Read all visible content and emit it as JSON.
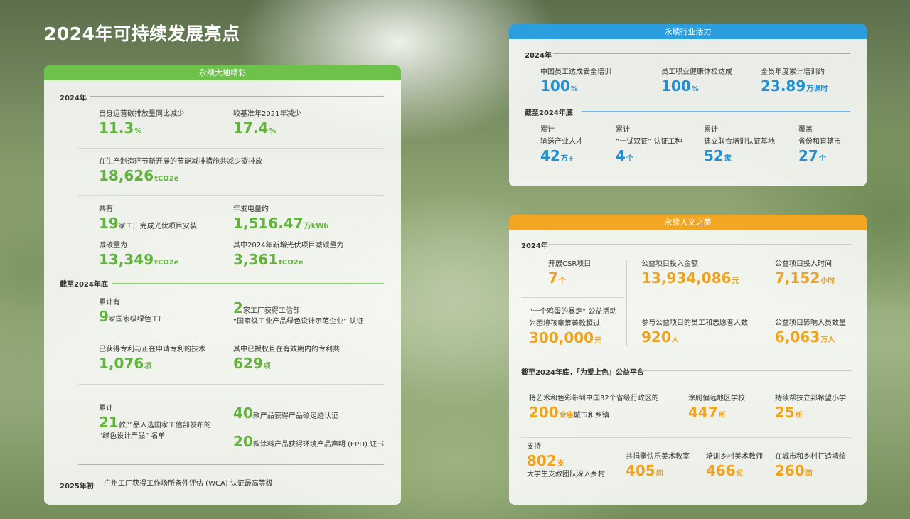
{
  "page_title": "2024年可持续发展亮点",
  "colors": {
    "green": "#5fb53a",
    "blue": "#1f8fd6",
    "orange": "#f0a21c"
  },
  "green_panel": {
    "header": "永续大地精彩",
    "sec_2024": "2024年",
    "emission_label": "自身运营碳排放量同比减少",
    "emission_value": "11.3",
    "emission_unit": "%",
    "baseline_label": "较基准年2021年减少",
    "baseline_value": "17.4",
    "baseline_unit": "%",
    "energy_label": "在生产制造环节新开展的节能减排措施共减少碳排放",
    "energy_value": "18,626",
    "energy_unit": "tCO2e",
    "pv_prefix": "共有",
    "pv_value": "19",
    "pv_suffix": "家工厂完成光伏项目安装",
    "power_label": "年发电量约",
    "power_value": "1,516.47",
    "power_unit": "万kWh",
    "reduce_label": "减碳量为",
    "reduce_value": "13,349",
    "reduce_unit": "tCO2e",
    "newpv_label": "其中2024年新增光伏项目减碳量为",
    "newpv_value": "3,361",
    "newpv_unit": "tCO2e",
    "sec_end": "截至2024年底",
    "green_factory_prefix": "累计有",
    "green_factory_value": "9",
    "green_factory_suffix": "家国家级绿色工厂",
    "miit_value": "2",
    "miit_suffix": "家工厂获得工信部",
    "miit_note": "“国家级工业产品绿色设计示范企业” 认证",
    "patent_label": "已获得专利与正在申请专利的技术",
    "patent_value": "1,076",
    "patent_unit": "项",
    "valid_label": "其中已授权且在有效期内的专利共",
    "valid_value": "629",
    "valid_unit": "项",
    "gd_prefix": "累计",
    "gd_value": "21",
    "gd_suffix": "款产品入选国家工信部发布的",
    "gd_note": "“绿色设计产品” 名单",
    "cf_value": "40",
    "cf_suffix": "款产品获得产品碳足迹认证",
    "epd_value": "20",
    "epd_suffix": "款涂料产品获得环境产品声明 (EPD) 证书",
    "year2025": "2025年初",
    "wca": "广州工厂获得工作场所条件评估 (WCA) 认证最高等级"
  },
  "blue_panel": {
    "header": "永续行业活力",
    "sec_2024": "2024年",
    "safety_label": "中国员工达成安全培训",
    "safety_value": "100",
    "safety_unit": "%",
    "health_label": "员工职业健康体检达成",
    "health_value": "100",
    "health_unit": "%",
    "train_label": "全员年度累计培训约",
    "train_value": "23.89",
    "train_unit": "万课时",
    "sec_end": "截至2024年底",
    "talent_l1": "累计",
    "talent_l2": "输送产业人才",
    "talent_value": "42",
    "talent_unit": "万+",
    "cert_l1": "累计",
    "cert_l2": "“一试双证” 认证工种",
    "cert_value": "4",
    "cert_unit": "个",
    "base_l1": "累计",
    "base_l2": "建立联合培训认证基地",
    "base_value": "52",
    "base_unit": "家",
    "cover_l1": "覆盖",
    "cover_l2": "省份和直辖市",
    "cover_value": "27",
    "cover_unit": "个"
  },
  "orange_panel": {
    "header": "永续人文之美",
    "sec_2024": "2024年",
    "csr_label": "开展CSR项目",
    "csr_value": "7",
    "csr_unit": "个",
    "invest_label": "公益项目投入金额",
    "invest_value": "13,934,086",
    "invest_unit": "元",
    "time_label": "公益项目投入时间",
    "time_value": "7,152",
    "time_unit": "小时",
    "egg_l1": "“一个鸡蛋的暴走” 公益活动",
    "egg_l2": "为困境孩童筹善款超过",
    "egg_value": "300,000",
    "egg_unit": "元",
    "vol_label": "参与公益项目的员工和志愿者人数",
    "vol_value": "920",
    "vol_unit": "人",
    "impact_label": "公益项目影响人员数量",
    "impact_value": "6,063",
    "impact_unit": "万人",
    "sec_end": "截至2024年底，「为爱上色」公益平台",
    "art_label": "将艺术和色彩带到中国32个省级行政区的",
    "art_value": "200",
    "art_unit": "余座",
    "art_suffix": "城市和乡镇",
    "school_label": "涂刷偏远地区学校",
    "school_value": "447",
    "school_unit": "所",
    "hope_label": "持续帮扶立邦希望小学",
    "hope_value": "25",
    "hope_unit": "所",
    "team_l1": "支持",
    "team_value": "802",
    "team_unit": "支",
    "team_l2": "大学生支教团队深入乡村",
    "class_label": "共捐赠快乐美术教室",
    "class_value": "405",
    "class_unit": "间",
    "teacher_label": "培训乡村美术教师",
    "teacher_value": "466",
    "teacher_unit": "位",
    "wall_label": "在城市和乡村打造墙绘",
    "wall_value": "260",
    "wall_unit": "面"
  }
}
